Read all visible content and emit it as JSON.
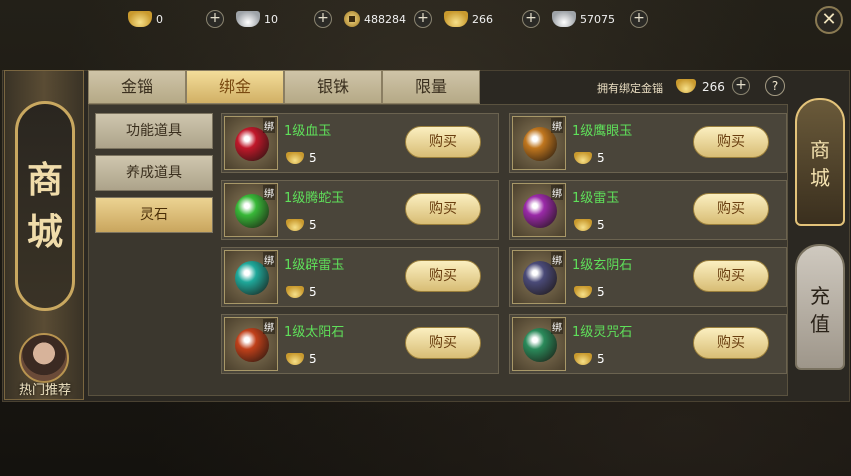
{
  "topbar": {
    "currencies": [
      {
        "icon": "gold-ingot-icon",
        "value": "0"
      },
      {
        "icon": "silver-ingot-icon",
        "value": "10"
      },
      {
        "icon": "copper-coin-icon",
        "value": "488284"
      },
      {
        "icon": "gold-ingot-icon",
        "value": "266"
      },
      {
        "icon": "silver-ingot-icon",
        "value": "57075"
      }
    ],
    "plus": "+",
    "close": "✕"
  },
  "banner": {
    "title_chars": [
      "商",
      "城"
    ],
    "hot_label": "热门推荐"
  },
  "tabs": [
    "金锱",
    "绑金",
    "银铢",
    "限量"
  ],
  "active_tab": 1,
  "bound_gold": {
    "label": "拥有绑定金锱",
    "value": "266",
    "help": "?"
  },
  "categories": [
    "功能道具",
    "养成道具",
    "灵石"
  ],
  "active_category": 2,
  "items": [
    {
      "name": "1级血玉",
      "price": "5",
      "tag": "绑",
      "buy": "购买",
      "color": "#c0182a"
    },
    {
      "name": "1级鹰眼玉",
      "price": "5",
      "tag": "绑",
      "buy": "购买",
      "color": "#c0761e"
    },
    {
      "name": "1级腾蛇玉",
      "price": "5",
      "tag": "绑",
      "buy": "购买",
      "color": "#38b838"
    },
    {
      "name": "1级雷玉",
      "price": "5",
      "tag": "绑",
      "buy": "购买",
      "color": "#9a2aa8"
    },
    {
      "name": "1级辟雷玉",
      "price": "5",
      "tag": "绑",
      "buy": "购买",
      "color": "#1fa89a"
    },
    {
      "name": "1级玄阴石",
      "price": "5",
      "tag": "绑",
      "buy": "购买",
      "color": "#4a4a78"
    },
    {
      "name": "1级太阳石",
      "price": "5",
      "tag": "绑",
      "buy": "购买",
      "color": "#c0401a"
    },
    {
      "name": "1级灵咒石",
      "price": "5",
      "tag": "绑",
      "buy": "购买",
      "color": "#2a8a5a"
    }
  ],
  "side_tabs": [
    {
      "chars": [
        "商",
        "城"
      ]
    },
    {
      "chars": [
        "充",
        "值"
      ]
    }
  ]
}
